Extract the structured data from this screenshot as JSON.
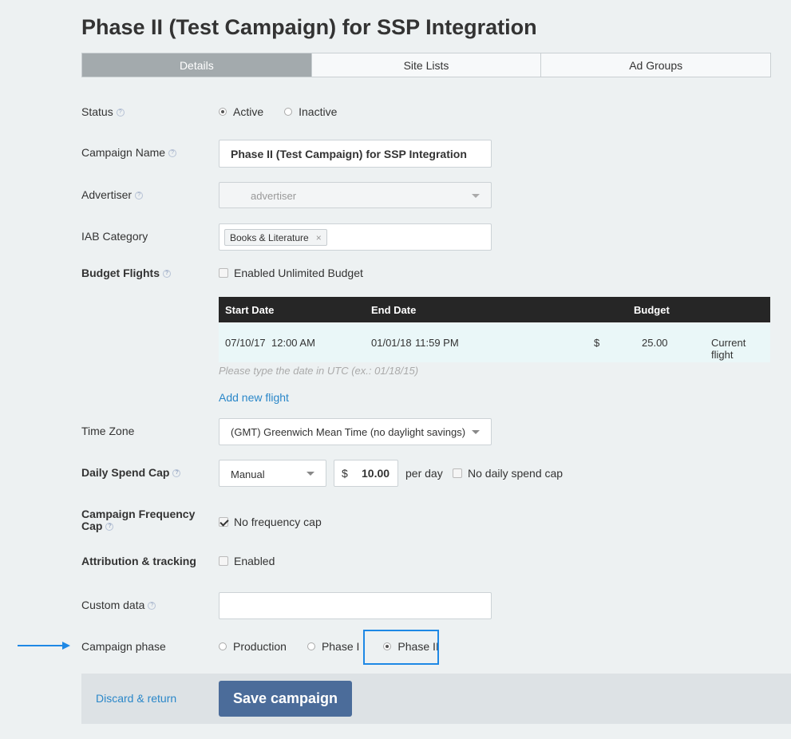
{
  "page_title": "Phase II (Test Campaign) for SSP Integration",
  "tabs": [
    {
      "label": "Details",
      "active": true
    },
    {
      "label": "Site Lists",
      "active": false
    },
    {
      "label": "Ad Groups",
      "active": false
    }
  ],
  "status": {
    "label": "Status",
    "options": [
      {
        "label": "Active",
        "selected": true
      },
      {
        "label": "Inactive",
        "selected": false
      }
    ]
  },
  "campaign_name": {
    "label": "Campaign Name",
    "value": "Phase II (Test Campaign) for SSP Integration"
  },
  "advertiser": {
    "label": "Advertiser",
    "value": "advertiser"
  },
  "iab_category": {
    "label": "IAB Category",
    "tag": "Books & Literature",
    "remove_glyph": "×"
  },
  "budget_flights": {
    "label": "Budget Flights",
    "unlimited_label": "Enabled Unlimited Budget",
    "unlimited_checked": false,
    "columns": {
      "start": "Start Date",
      "end": "End Date",
      "budget": "Budget"
    },
    "rows": [
      {
        "start_date": "07/10/17",
        "start_time": "12:00 AM",
        "end_date": "01/01/18",
        "end_time": "11:59 PM",
        "currency": "$",
        "amount": "25.00",
        "note": "Current flight"
      }
    ],
    "hint": "Please type the date in UTC (ex.: 01/18/15)",
    "add_link": "Add new flight"
  },
  "time_zone": {
    "label": "Time Zone",
    "value": "(GMT) Greenwich Mean Time (no daylight savings)"
  },
  "daily_spend_cap": {
    "label": "Daily Spend Cap",
    "mode": "Manual",
    "currency": "$",
    "amount": "10.00",
    "per_day": "per day",
    "no_cap_label": "No daily spend cap",
    "no_cap_checked": false
  },
  "frequency_cap": {
    "label_line1": "Campaign Frequency",
    "label_line2": "Cap",
    "option_label": "No frequency cap",
    "checked": true
  },
  "attribution": {
    "label": "Attribution & tracking",
    "option_label": "Enabled",
    "checked": false
  },
  "custom_data": {
    "label": "Custom data",
    "value": ""
  },
  "campaign_phase": {
    "label": "Campaign phase",
    "options": [
      {
        "label": "Production",
        "selected": false
      },
      {
        "label": "Phase I",
        "selected": false
      },
      {
        "label": "Phase II",
        "selected": true
      }
    ]
  },
  "footer": {
    "discard_label": "Discard & return",
    "save_label": "Save campaign"
  },
  "help_glyph": "?",
  "colors": {
    "accent_link": "#2a87c9",
    "save_button": "#4b6c9a",
    "highlight_box": "#1e88e5",
    "active_tab": "#a3aaad",
    "table_header": "#262626"
  }
}
